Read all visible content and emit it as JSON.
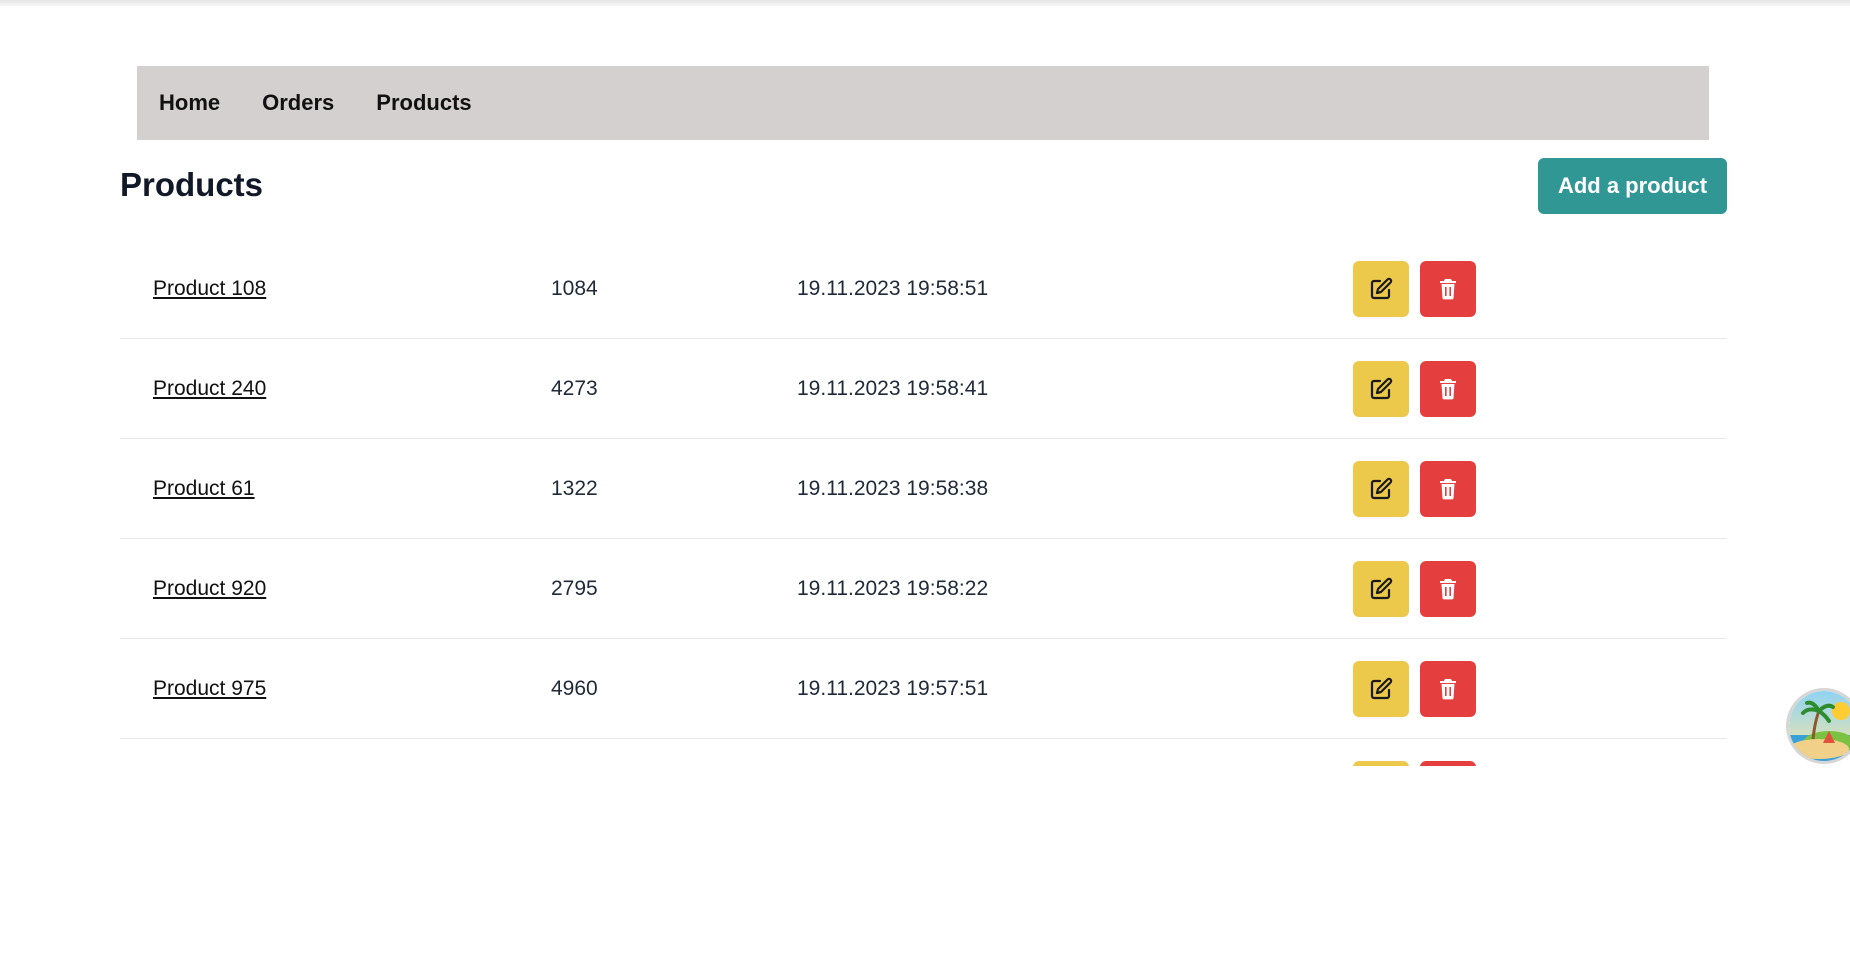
{
  "nav": {
    "items": [
      {
        "label": "Home"
      },
      {
        "label": "Orders"
      },
      {
        "label": "Products"
      }
    ]
  },
  "page": {
    "title": "Products",
    "add_button_label": "Add a product"
  },
  "table": {
    "rows": [
      {
        "name": "Product 108",
        "quantity": "1084",
        "date": "19.11.2023 19:58:51"
      },
      {
        "name": "Product 240",
        "quantity": "4273",
        "date": "19.11.2023 19:58:41"
      },
      {
        "name": "Product 61",
        "quantity": "1322",
        "date": "19.11.2023 19:58:38"
      },
      {
        "name": "Product 920",
        "quantity": "2795",
        "date": "19.11.2023 19:58:22"
      },
      {
        "name": "Product 975",
        "quantity": "4960",
        "date": "19.11.2023 19:57:51"
      },
      {
        "name": "",
        "quantity": "",
        "date": ""
      }
    ]
  },
  "icons": {
    "edit": "edit-icon",
    "delete": "trash-icon",
    "floating": "island-avatar-icon"
  },
  "colors": {
    "nav_bg": "#d4d0d0",
    "add_button": "#319795",
    "edit_button": "#ecc94b",
    "delete_button": "#e53e3e"
  }
}
